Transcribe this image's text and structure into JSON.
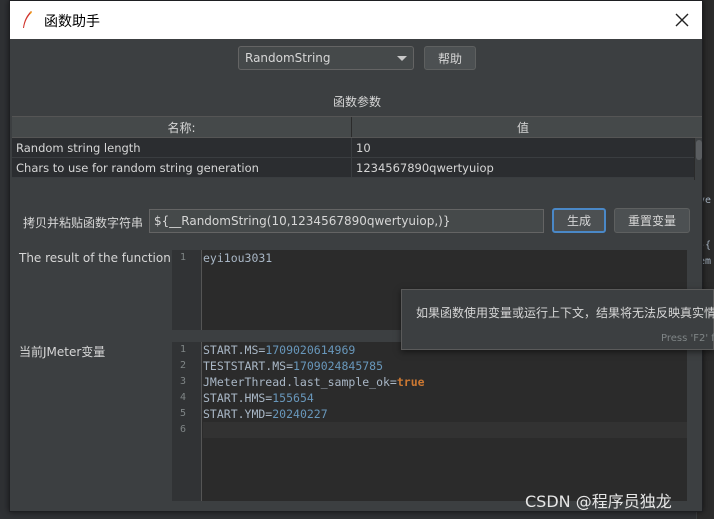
{
  "window": {
    "title": "函数助手",
    "close_icon": "close-icon"
  },
  "selector": {
    "function_value": "RandomString",
    "help_label": "帮助"
  },
  "params": {
    "section_title": "函数参数",
    "columns": [
      "名称:",
      "值"
    ],
    "rows": [
      {
        "name": "Random string length",
        "value": "10"
      },
      {
        "name": "Chars to use for random string generation",
        "value": "1234567890qwertyuiop"
      }
    ]
  },
  "copy": {
    "label": "拷贝并粘贴函数字符串",
    "value": "${__RandomString(10,1234567890qwertyuiop,)}",
    "generate_label": "生成",
    "reset_label": "重置变量"
  },
  "result": {
    "label": "The result of the function is",
    "line_numbers": [
      "1"
    ],
    "value": "eyi1ou3031"
  },
  "vars": {
    "label": "当前JMeter变量",
    "line_numbers": [
      "1",
      "2",
      "3",
      "4",
      "5",
      "6"
    ],
    "lines": [
      {
        "key": "START.MS=",
        "val": "1709020614969",
        "kind": "num"
      },
      {
        "key": "TESTSTART.MS=",
        "val": "1709024845785",
        "kind": "num"
      },
      {
        "key": "JMeterThread.last_sample_ok=",
        "val": "true",
        "kind": "kw"
      },
      {
        "key": "START.HMS=",
        "val": "155654",
        "kind": "num"
      },
      {
        "key": "START.YMD=",
        "val": "20240227",
        "kind": "num"
      },
      {
        "key": "",
        "val": "",
        "kind": "num"
      }
    ]
  },
  "tooltip": {
    "text": "如果函数使用变量或运行上下文，结果将无法反映真实情",
    "hint": "Press 'F2' f"
  },
  "watermark": "CSDN @程序员独龙",
  "colors": {
    "accent": "#4a88c7",
    "number": "#6897bb",
    "keyword": "#cc7832"
  }
}
